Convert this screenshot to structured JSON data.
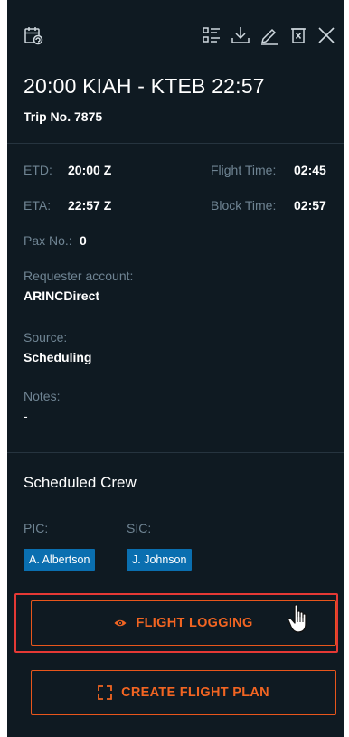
{
  "header": {
    "icons": [
      "calendar-icon",
      "list-icon",
      "download-icon",
      "edit-icon",
      "delete-icon",
      "close-icon"
    ]
  },
  "trip": {
    "route": "20:00 KIAH - KTEB 22:57",
    "trip_no": "Trip No. 7875"
  },
  "details": {
    "etd_label": "ETD:",
    "etd_value": "20:00 Z",
    "eta_label": "ETA:",
    "eta_value": "22:57 Z",
    "flight_time_label": "Flight Time:",
    "flight_time_value": "02:45",
    "block_time_label": "Block Time:",
    "block_time_value": "02:57",
    "pax_label": "Pax No.:",
    "pax_value": "0",
    "requester_label": "Requester account:",
    "requester_value": "ARINCDirect",
    "source_label": "Source:",
    "source_value": "Scheduling",
    "notes_label": "Notes:",
    "notes_value": "-"
  },
  "crew": {
    "title": "Scheduled Crew",
    "pic_label": "PIC:",
    "sic_label": "SIC:",
    "pic_name": "A. Albertson",
    "sic_name": "J. Johnson"
  },
  "actions": {
    "flight_logging_label": "FLIGHT LOGGING",
    "create_flight_plan_label": "CREATE FLIGHT PLAN"
  },
  "colors": {
    "panel_bg": "#0f1a22",
    "accent_orange": "#f26522",
    "badge_blue": "#0a6fb0",
    "highlight_red": "#e53935"
  }
}
